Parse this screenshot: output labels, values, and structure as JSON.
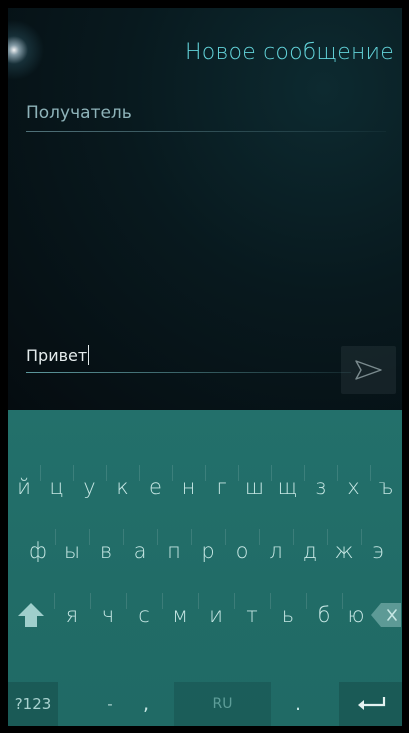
{
  "header": {
    "title": "Новое сообщение"
  },
  "compose": {
    "recipient_placeholder": "Получатель",
    "message_text": "Привет"
  },
  "keyboard": {
    "row1": [
      "й",
      "ц",
      "у",
      "к",
      "е",
      "н",
      "г",
      "ш",
      "щ",
      "з",
      "х",
      "ъ"
    ],
    "row2": [
      "ф",
      "ы",
      "в",
      "а",
      "п",
      "р",
      "о",
      "л",
      "д",
      "ж",
      "э"
    ],
    "row3": [
      "я",
      "ч",
      "с",
      "м",
      "и",
      "т",
      "ь",
      "б",
      "ю"
    ],
    "symbols_label": "?123",
    "dash_label": "-",
    "comma_label": ",",
    "language_label": "RU",
    "period_label": ".",
    "icons": {
      "shift": "shift-arrow-icon",
      "backspace": "backspace-icon",
      "enter": "enter-return-icon",
      "send": "send-arrow-icon"
    }
  },
  "colors": {
    "accent": "#62d2d8",
    "keyboard_bg": "#216c67"
  }
}
